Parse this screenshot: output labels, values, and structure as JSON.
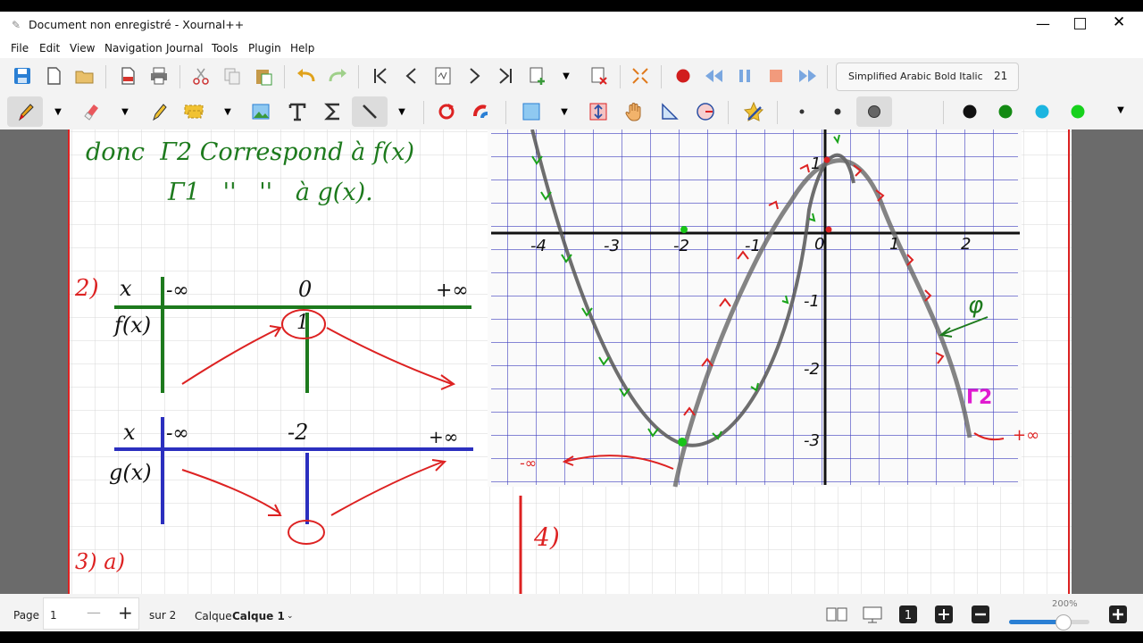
{
  "window": {
    "title": "Document non enregistré - Xournal++"
  },
  "menu": [
    "File",
    "Edit",
    "View",
    "Navigation",
    "Journal",
    "Tools",
    "Plugin",
    "Help"
  ],
  "font": {
    "name": "Simplified Arabic Bold Italic",
    "size": "21"
  },
  "notes": {
    "line1": "donc  Γ2 Correspond à f(x)",
    "line2": "Γ1   ''   ''   à g(x).",
    "q2": "2)",
    "q3": "3) a)",
    "q4": "4)",
    "tab1": {
      "x": "x",
      "fx": "f(x)",
      "minf": "-∞",
      "zero": "0",
      "pinf": "+∞",
      "val": "1"
    },
    "tab2": {
      "x": "x",
      "gx": "g(x)",
      "minf": "-∞",
      "m2": "-2",
      "pinf": "+∞"
    }
  },
  "graph": {
    "xticks": [
      "-4",
      "-3",
      "-2",
      "-1",
      "0",
      "1",
      "2"
    ],
    "yticks": [
      "1",
      "-1",
      "-2",
      "-3"
    ],
    "label_phi": "φ",
    "label_gamma2": "Γ2",
    "label_pinf": "+∞",
    "label_minf": "-∞"
  },
  "status": {
    "page_label": "Page",
    "page_value": "1",
    "of_label": "sur 2",
    "layer_label": "Calque",
    "layer_value": "Calque 1",
    "zoom": "200%"
  },
  "colors": {
    "accent": "#2a7fd4",
    "red": "#e8332c",
    "green": "#1d7a1d",
    "blue": "#2b2fbf"
  }
}
